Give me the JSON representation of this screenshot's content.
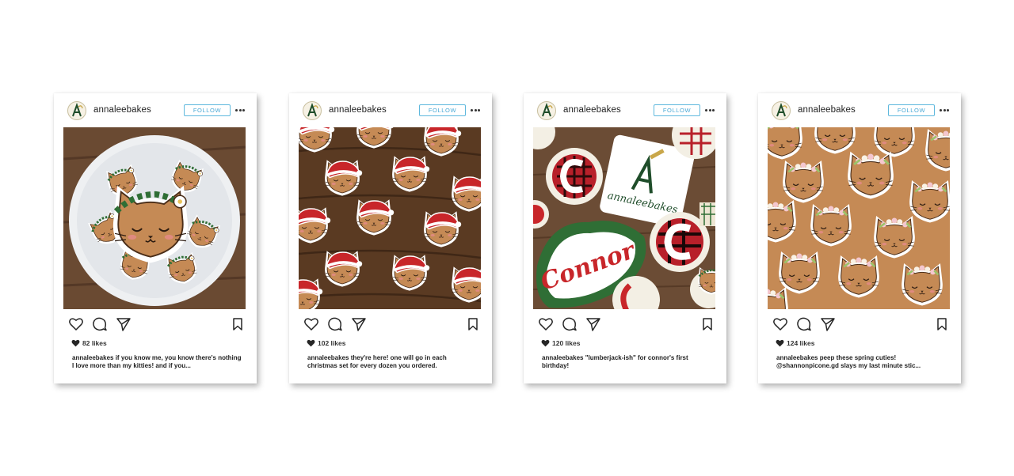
{
  "colors": {
    "follow_accent": "#4aa9d6",
    "wood": "#5a3a22",
    "cookie": "#c58a55",
    "santa_red": "#c8262a",
    "leaf_green": "#2f6e35"
  },
  "icons": [
    "heart-icon",
    "comment-icon",
    "share-icon",
    "bookmark-icon",
    "more-icon",
    "avatar-logo-icon"
  ],
  "posts": [
    {
      "username": "annaleebakes",
      "follow_label": "FOLLOW",
      "likes": "82 likes",
      "caption_user": "annaleebakes",
      "caption_text": " if you know me, you know there's nothing I love more than my kitties! and if you..."
    },
    {
      "username": "annaleebakes",
      "follow_label": "FOLLOW",
      "likes": "102 likes",
      "caption_user": "annaleebakes",
      "caption_text": " they're here! one will go in each christmas set for every dozen you ordered."
    },
    {
      "username": "annaleebakes",
      "follow_label": "FOLLOW",
      "likes": "120 likes",
      "caption_user": "annaleebakes",
      "caption_text": " \"lumberjack-ish\" for connor's first birthday!",
      "photo_text": {
        "logo_script": "annaleebakes",
        "cookie_name": "Connor"
      }
    },
    {
      "username": "annaleebakes",
      "follow_label": "FOLLOW",
      "likes": "124 likes",
      "caption_user": "annaleebakes",
      "caption_text": " peep these spring cuties! @shannonpicone.gd slays my last minute stic..."
    }
  ]
}
